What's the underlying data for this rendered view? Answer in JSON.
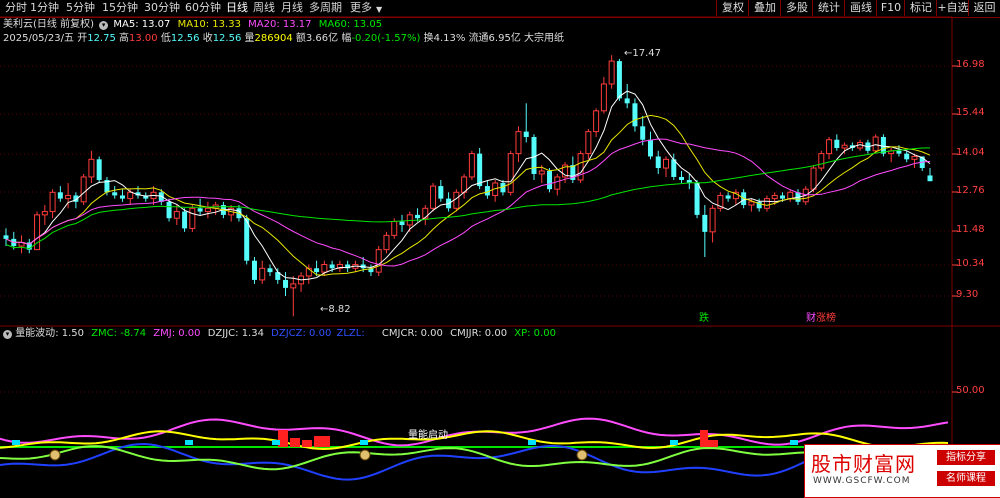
{
  "toolbar": {
    "tabs": [
      "分时",
      "1分钟",
      "5分钟",
      "15分钟",
      "30分钟",
      "60分钟",
      "日线",
      "周线",
      "月线",
      "多周期",
      "更多"
    ],
    "active_tab": "日线",
    "buttons": [
      "复权",
      "叠加",
      "多股",
      "统计",
      "画线",
      "F10",
      "标记",
      "+自选",
      "返回"
    ]
  },
  "stock": {
    "name": "美利云(日线 前复权)",
    "ma5": "MA5: 13.07",
    "ma10": "MA10: 13.33",
    "ma20": "MA20: 13.17",
    "ma60": "MA60: 13.05",
    "date": "2025/05/23/五",
    "open_label": "开",
    "open": "12.75",
    "high_label": "高",
    "high": "13.00",
    "low_label": "低",
    "low": "12.56",
    "close_label": "收",
    "close": "12.56",
    "vol_label": "量",
    "vol": "286904",
    "amount_label": "额",
    "amount": "3.66亿",
    "change_label": "幅",
    "change": "-0.20(-1.57%)",
    "turnover": "换4.13%",
    "float_cap": "流通6.95亿",
    "category": "大宗用纸"
  },
  "price_axis": [
    "16.98",
    "15.44",
    "14.04",
    "12.76",
    "11.48",
    "10.34",
    "9.30"
  ],
  "annotations": {
    "high_mark": "17.47",
    "low_mark": "8.82",
    "tag1": "跌",
    "tag2_a": "财",
    "tag2_b": "涨榜"
  },
  "indicator": {
    "name": "量能波动",
    "value": ": 1.50",
    "zmc": "ZMC: -8.74",
    "zmj": "ZMJ: 0.00",
    "dzjjc": "DZJJC: 1.34",
    "dzjcz": "DZJCZ: 0.00",
    "zlzl": "ZLZL:",
    "cmjcr": "CMJCR: 0.00",
    "cmjjr": "CMJJR: 0.00",
    "xp": "XP: 0.00",
    "axis": "50.00",
    "signal_text": "量能启动"
  },
  "watermark": {
    "title": "股市财富网",
    "site": "WWW.GSCFW.COM",
    "tag1": "指标分享",
    "tag2": "名师课程"
  },
  "colors": {
    "up": "#ff3c3c",
    "down": "#54fcfc",
    "ma5": "#ffffff",
    "ma10": "#e8e800",
    "ma20": "#ff4cff",
    "ma60": "#00e600"
  },
  "candles": [
    [
      10.9,
      11.1,
      10.6,
      10.8
    ],
    [
      10.8,
      11.0,
      10.5,
      10.6
    ],
    [
      10.6,
      10.9,
      10.4,
      10.7
    ],
    [
      10.7,
      10.8,
      10.4,
      10.5
    ],
    [
      10.5,
      11.6,
      10.5,
      11.5
    ],
    [
      11.5,
      11.8,
      11.2,
      11.6
    ],
    [
      11.6,
      12.3,
      11.4,
      12.2
    ],
    [
      12.2,
      12.4,
      11.9,
      12.0
    ],
    [
      12.0,
      12.5,
      11.7,
      12.1
    ],
    [
      12.1,
      12.2,
      11.7,
      11.9
    ],
    [
      11.9,
      12.8,
      11.8,
      12.7
    ],
    [
      12.7,
      13.6,
      12.5,
      13.3
    ],
    [
      13.3,
      13.4,
      12.5,
      12.6
    ],
    [
      12.6,
      12.7,
      12.1,
      12.2
    ],
    [
      12.2,
      12.4,
      12.0,
      12.1
    ],
    [
      12.1,
      12.3,
      11.9,
      12.0
    ],
    [
      12.0,
      12.3,
      11.8,
      12.2
    ],
    [
      12.2,
      12.4,
      12.0,
      12.1
    ],
    [
      12.1,
      12.2,
      11.9,
      12.0
    ],
    [
      12.0,
      12.4,
      11.8,
      12.2
    ],
    [
      12.2,
      12.3,
      11.8,
      11.9
    ],
    [
      11.9,
      12.0,
      11.3,
      11.4
    ],
    [
      11.4,
      11.8,
      11.2,
      11.6
    ],
    [
      11.6,
      11.7,
      11.0,
      11.1
    ],
    [
      11.1,
      11.8,
      11.0,
      11.7
    ],
    [
      11.7,
      12.0,
      11.5,
      11.6
    ],
    [
      11.6,
      11.9,
      11.4,
      11.7
    ],
    [
      11.7,
      11.9,
      11.5,
      11.8
    ],
    [
      11.8,
      11.9,
      11.4,
      11.5
    ],
    [
      11.5,
      11.8,
      11.3,
      11.7
    ],
    [
      11.7,
      11.8,
      11.3,
      11.4
    ],
    [
      11.4,
      11.5,
      10.1,
      10.2
    ],
    [
      10.2,
      10.3,
      9.6,
      9.7
    ],
    [
      9.7,
      10.2,
      9.6,
      10.0
    ],
    [
      10.0,
      10.1,
      9.8,
      9.9
    ],
    [
      9.9,
      10.0,
      9.6,
      9.7
    ],
    [
      9.7,
      9.9,
      9.3,
      9.5
    ],
    [
      9.5,
      9.8,
      8.82,
      9.6
    ],
    [
      9.6,
      9.9,
      9.4,
      9.8
    ],
    [
      9.8,
      10.1,
      9.6,
      10.0
    ],
    [
      10.0,
      10.2,
      9.8,
      9.9
    ],
    [
      9.9,
      10.2,
      9.8,
      10.1
    ],
    [
      10.1,
      10.2,
      9.9,
      10.0
    ],
    [
      10.0,
      10.2,
      9.9,
      10.1
    ],
    [
      10.1,
      10.2,
      9.9,
      10.0
    ],
    [
      10.0,
      10.2,
      9.9,
      10.1
    ],
    [
      10.1,
      10.3,
      9.9,
      10.0
    ],
    [
      10.0,
      10.1,
      9.8,
      9.9
    ],
    [
      9.9,
      10.6,
      9.8,
      10.5
    ],
    [
      10.5,
      11.0,
      10.4,
      10.9
    ],
    [
      10.9,
      11.4,
      10.8,
      11.3
    ],
    [
      11.3,
      11.5,
      11.0,
      11.2
    ],
    [
      11.2,
      11.6,
      11.0,
      11.5
    ],
    [
      11.5,
      11.7,
      11.3,
      11.4
    ],
    [
      11.4,
      11.8,
      11.2,
      11.7
    ],
    [
      11.7,
      12.5,
      11.6,
      12.4
    ],
    [
      12.4,
      12.6,
      11.9,
      12.0
    ],
    [
      12.0,
      12.2,
      11.6,
      11.7
    ],
    [
      11.7,
      12.3,
      11.6,
      12.2
    ],
    [
      12.2,
      12.8,
      12.0,
      12.7
    ],
    [
      12.7,
      13.6,
      12.6,
      13.5
    ],
    [
      13.5,
      13.7,
      12.3,
      12.4
    ],
    [
      12.4,
      12.6,
      12.0,
      12.1
    ],
    [
      12.1,
      12.6,
      11.9,
      12.5
    ],
    [
      12.5,
      12.6,
      12.1,
      12.2
    ],
    [
      12.2,
      13.6,
      12.1,
      13.5
    ],
    [
      13.5,
      14.5,
      13.2,
      14.3
    ],
    [
      14.3,
      15.4,
      13.9,
      14.1
    ],
    [
      14.1,
      14.2,
      12.6,
      12.8
    ],
    [
      12.8,
      13.1,
      12.5,
      12.9
    ],
    [
      12.9,
      13.0,
      12.2,
      12.3
    ],
    [
      12.3,
      12.8,
      12.1,
      12.7
    ],
    [
      12.7,
      13.2,
      12.5,
      13.1
    ],
    [
      13.1,
      13.4,
      12.5,
      12.6
    ],
    [
      12.6,
      13.6,
      12.5,
      13.5
    ],
    [
      13.5,
      14.4,
      13.3,
      14.3
    ],
    [
      14.3,
      15.2,
      14.1,
      15.1
    ],
    [
      15.1,
      16.5,
      15.0,
      16.2
    ],
    [
      16.2,
      17.47,
      16.0,
      17.2
    ],
    [
      17.2,
      17.3,
      15.5,
      15.6
    ],
    [
      15.6,
      16.2,
      15.2,
      15.4
    ],
    [
      15.4,
      15.6,
      14.3,
      14.5
    ],
    [
      14.5,
      14.9,
      13.8,
      14.0
    ],
    [
      14.0,
      14.3,
      13.3,
      13.4
    ],
    [
      13.4,
      13.6,
      12.8,
      13.0
    ],
    [
      13.0,
      13.4,
      12.7,
      13.3
    ],
    [
      13.3,
      13.5,
      12.6,
      12.7
    ],
    [
      12.7,
      12.9,
      12.5,
      12.6
    ],
    [
      12.6,
      12.8,
      12.3,
      12.5
    ],
    [
      12.5,
      12.6,
      11.4,
      11.5
    ],
    [
      11.5,
      11.8,
      10.3,
      11.0
    ],
    [
      11.0,
      11.8,
      10.7,
      11.7
    ],
    [
      11.7,
      12.2,
      11.6,
      12.1
    ],
    [
      12.1,
      12.2,
      11.9,
      12.0
    ],
    [
      12.0,
      12.3,
      11.8,
      12.2
    ],
    [
      12.2,
      12.3,
      11.7,
      11.8
    ],
    [
      11.8,
      12.0,
      11.6,
      11.9
    ],
    [
      11.9,
      12.0,
      11.6,
      11.7
    ],
    [
      11.7,
      12.1,
      11.6,
      12.0
    ],
    [
      12.0,
      12.2,
      11.8,
      12.1
    ],
    [
      12.1,
      12.2,
      11.9,
      12.0
    ],
    [
      12.0,
      12.3,
      11.9,
      12.2
    ],
    [
      12.2,
      12.3,
      11.8,
      11.9
    ],
    [
      11.9,
      12.4,
      11.8,
      12.3
    ],
    [
      12.3,
      13.1,
      12.2,
      13.0
    ],
    [
      13.0,
      13.6,
      12.9,
      13.5
    ],
    [
      13.5,
      14.1,
      13.3,
      14.0
    ],
    [
      14.0,
      14.2,
      13.6,
      13.7
    ],
    [
      13.7,
      13.9,
      13.5,
      13.8
    ],
    [
      13.8,
      13.9,
      13.6,
      13.7
    ],
    [
      13.7,
      14.0,
      13.6,
      13.9
    ],
    [
      13.9,
      14.0,
      13.5,
      13.6
    ],
    [
      13.6,
      14.2,
      13.5,
      14.1
    ],
    [
      14.1,
      14.2,
      13.4,
      13.5
    ],
    [
      13.5,
      13.7,
      13.2,
      13.6
    ],
    [
      13.6,
      13.8,
      13.4,
      13.5
    ],
    [
      13.5,
      13.6,
      13.2,
      13.3
    ],
    [
      13.3,
      13.5,
      13.0,
      13.4
    ],
    [
      13.4,
      13.4,
      12.9,
      13.0
    ],
    [
      12.75,
      13.0,
      12.56,
      12.56
    ]
  ]
}
